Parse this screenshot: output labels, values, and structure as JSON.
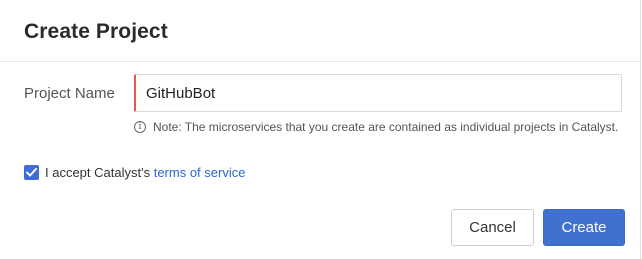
{
  "dialog": {
    "title": "Create Project"
  },
  "form": {
    "project_name_label": "Project Name",
    "project_name_value": "GitHubBot",
    "note_icon": "info-icon",
    "note_text": "Note: The microservices that you create are contained as individual projects in Catalyst."
  },
  "terms": {
    "checked": true,
    "prefix": "I accept Catalyst's",
    "link_text": "terms of service"
  },
  "actions": {
    "cancel_label": "Cancel",
    "create_label": "Create"
  },
  "colors": {
    "primary": "#4270cf",
    "link": "#2f64d6",
    "input_accent": "#e05a4e"
  }
}
